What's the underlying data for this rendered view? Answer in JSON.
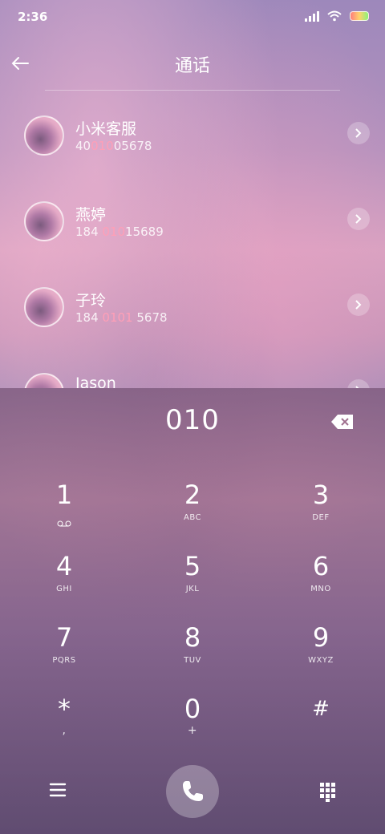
{
  "status": {
    "time": "2:36"
  },
  "header": {
    "title": "通话"
  },
  "contacts": [
    {
      "name": "小米客服",
      "pre": "40",
      "hl": "010",
      "post": "05678"
    },
    {
      "name": "燕婷",
      "pre": "184 ",
      "hl": "010",
      "post": "15689"
    },
    {
      "name": "子玲",
      "pre": "184 ",
      "hl": "0101",
      "post": " 5678"
    },
    {
      "name": "Jason",
      "pre": "",
      "hl": "",
      "post": ""
    }
  ],
  "dialpad": {
    "input": "010",
    "keys": [
      {
        "num": "1",
        "letters": ""
      },
      {
        "num": "2",
        "letters": "ABC"
      },
      {
        "num": "3",
        "letters": "DEF"
      },
      {
        "num": "4",
        "letters": "GHI"
      },
      {
        "num": "5",
        "letters": "JKL"
      },
      {
        "num": "6",
        "letters": "MNO"
      },
      {
        "num": "7",
        "letters": "PQRS"
      },
      {
        "num": "8",
        "letters": "TUV"
      },
      {
        "num": "9",
        "letters": "WXYZ"
      },
      {
        "num": "*",
        "letters": ","
      },
      {
        "num": "0",
        "letters": "+"
      },
      {
        "num": "#",
        "letters": ""
      }
    ]
  },
  "colors": {
    "highlight": "#ff9fb7"
  },
  "icons": [
    "back-arrow-icon",
    "chevron-right-icon",
    "backspace-icon",
    "voicemail-icon",
    "menu-icon",
    "phone-icon",
    "dialpad-grid-icon"
  ]
}
